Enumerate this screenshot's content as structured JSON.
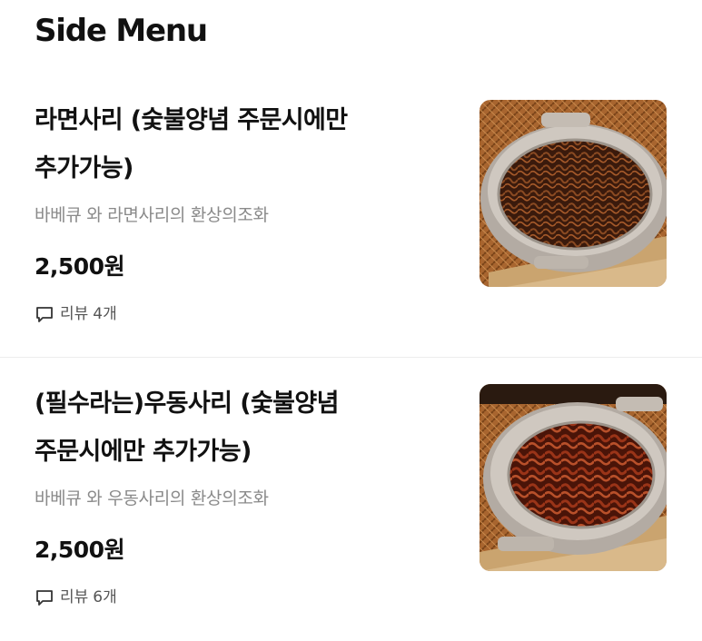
{
  "header": {
    "title": "Side Menu"
  },
  "items": [
    {
      "name_line1": "라면사리 (숯불양념 주문시에만",
      "name_line2": "추가가능)",
      "description": "바베큐 와 라면사리의 환상의조화",
      "price": "2,500원",
      "review_label": "리뷰",
      "review_count": "4개",
      "image_icon": "ramen-noodle-dish-photo"
    },
    {
      "name_line1": "(필수라는)우동사리 (숯불양념",
      "name_line2": "주문시에만 추가가능)",
      "description": "바베큐 와 우동사리의 환상의조화",
      "price": "2,500원",
      "review_label": "리뷰",
      "review_count": "6개",
      "image_icon": "udon-noodle-dish-photo"
    }
  ],
  "colors": {
    "text_primary": "#111111",
    "text_secondary": "#8a8a8a",
    "divider": "#ececec"
  }
}
